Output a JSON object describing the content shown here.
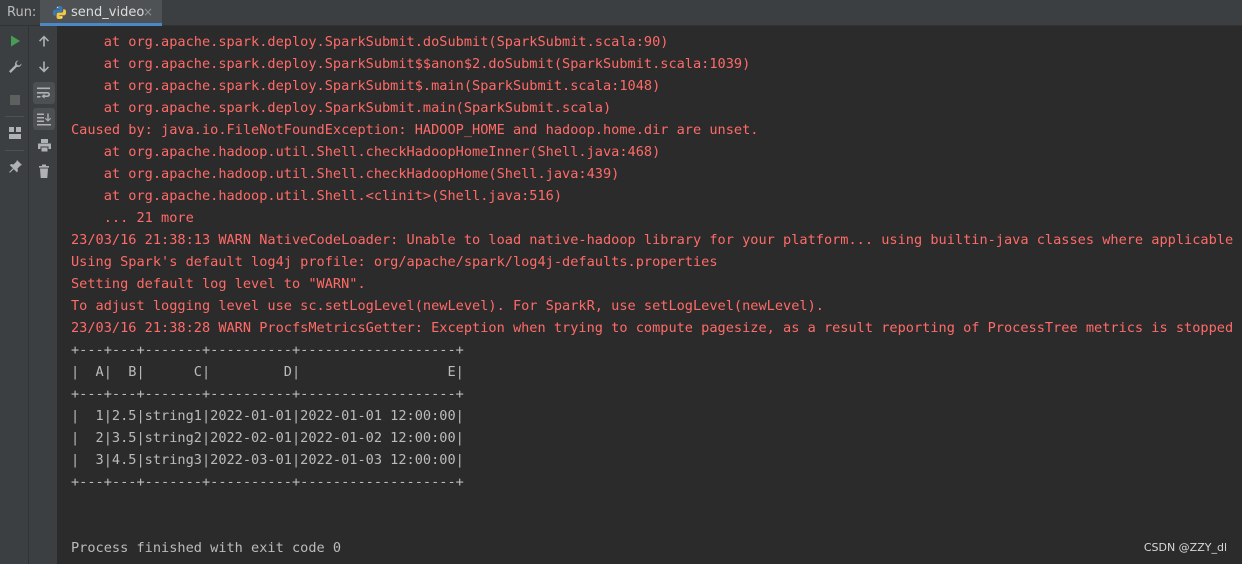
{
  "run_panel": {
    "label": "Run:",
    "tab": {
      "title": "send_video",
      "close": "×",
      "icon": "python-icon"
    }
  },
  "toolbar": {
    "left": [
      "run-icon",
      "wrench-icon",
      "stop-icon",
      "layout-icon",
      "pin-icon"
    ],
    "right": [
      "up-arrow-icon",
      "down-arrow-icon",
      "soft-wrap-icon",
      "scroll-to-end-icon",
      "print-icon",
      "trash-icon"
    ]
  },
  "colors": {
    "stderr": "#ff6b68",
    "stdout": "#bbbbbb",
    "background": "#2b2b2b",
    "accent": "#4a88c7"
  },
  "console": {
    "lines": [
      {
        "text": "\tat org.apache.spark.deploy.SparkSubmit.doSubmit(SparkSubmit.scala:90)",
        "stream": "stderr"
      },
      {
        "text": "\tat org.apache.spark.deploy.SparkSubmit$$anon$2.doSubmit(SparkSubmit.scala:1039)",
        "stream": "stderr"
      },
      {
        "text": "\tat org.apache.spark.deploy.SparkSubmit$.main(SparkSubmit.scala:1048)",
        "stream": "stderr"
      },
      {
        "text": "\tat org.apache.spark.deploy.SparkSubmit.main(SparkSubmit.scala)",
        "stream": "stderr"
      },
      {
        "text": "Caused by: java.io.FileNotFoundException: HADOOP_HOME and hadoop.home.dir are unset.",
        "stream": "stderr"
      },
      {
        "text": "\tat org.apache.hadoop.util.Shell.checkHadoopHomeInner(Shell.java:468)",
        "stream": "stderr"
      },
      {
        "text": "\tat org.apache.hadoop.util.Shell.checkHadoopHome(Shell.java:439)",
        "stream": "stderr"
      },
      {
        "text": "\tat org.apache.hadoop.util.Shell.<clinit>(Shell.java:516)",
        "stream": "stderr"
      },
      {
        "text": "\t... 21 more",
        "stream": "stderr"
      },
      {
        "text": "23/03/16 21:38:13 WARN NativeCodeLoader: Unable to load native-hadoop library for your platform... using builtin-java classes where applicable",
        "stream": "stderr"
      },
      {
        "text": "Using Spark's default log4j profile: org/apache/spark/log4j-defaults.properties",
        "stream": "stderr"
      },
      {
        "text": "Setting default log level to \"WARN\".",
        "stream": "stderr"
      },
      {
        "text": "To adjust logging level use sc.setLogLevel(newLevel). For SparkR, use setLogLevel(newLevel).",
        "stream": "stderr"
      },
      {
        "text": "23/03/16 21:38:28 WARN ProcfsMetricsGetter: Exception when trying to compute pagesize, as a result reporting of ProcessTree metrics is stopped",
        "stream": "stderr"
      },
      {
        "text": "+---+---+-------+----------+-------------------+",
        "stream": "stdout"
      },
      {
        "text": "|  A|  B|      C|         D|                  E|",
        "stream": "stdout"
      },
      {
        "text": "+---+---+-------+----------+-------------------+",
        "stream": "stdout"
      },
      {
        "text": "|  1|2.5|string1|2022-01-01|2022-01-01 12:00:00|",
        "stream": "stdout"
      },
      {
        "text": "|  2|3.5|string2|2022-02-01|2022-01-02 12:00:00|",
        "stream": "stdout"
      },
      {
        "text": "|  3|4.5|string3|2022-03-01|2022-01-03 12:00:00|",
        "stream": "stdout"
      },
      {
        "text": "+---+---+-------+----------+-------------------+",
        "stream": "stdout"
      },
      {
        "text": "",
        "stream": "stdout"
      },
      {
        "text": "",
        "stream": "stdout"
      },
      {
        "text": "Process finished with exit code 0",
        "stream": "stdout"
      }
    ]
  },
  "watermark": "CSDN @ZZY_dl"
}
